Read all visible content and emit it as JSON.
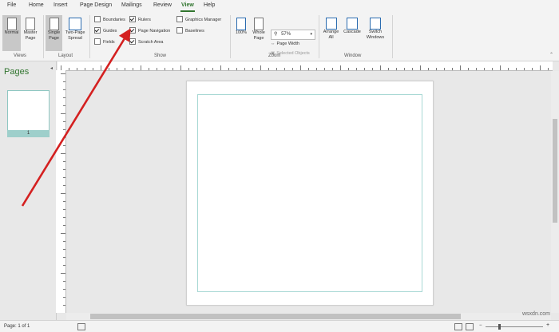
{
  "menu": {
    "items": [
      "File",
      "Home",
      "Insert",
      "Page Design",
      "Mailings",
      "Review",
      "View",
      "Help"
    ],
    "active": "View"
  },
  "ribbon": {
    "views": {
      "normal": "Normal",
      "master": "Master Page",
      "label": "Views"
    },
    "layout": {
      "single": "Single Page",
      "two_page": "Two-Page Spread",
      "label": "Layout"
    },
    "show": {
      "boundaries": "Boundaries",
      "rulers": "Rulers",
      "graphics_manager": "Graphics Manager",
      "guides": "Guides",
      "page_navigation": "Page Navigation",
      "baselines": "Baselines",
      "fields": "Fields",
      "scratch_area": "Scratch Area",
      "label": "Show"
    },
    "zoom": {
      "hundred": "100%",
      "whole_page": "Whole Page",
      "zoom_value": "57%",
      "page_width": "Page Width",
      "selected_objects": "Selected Objects",
      "label": "Zoom"
    },
    "window": {
      "arrange": "Arrange All",
      "cascade": "Cascade",
      "switch": "Switch Windows",
      "label": "Window"
    }
  },
  "pages_panel": {
    "title": "Pages",
    "page_number": "1"
  },
  "status": {
    "page_info": "Page: 1 of 1"
  },
  "watermark": "wsxdn.com",
  "colors": {
    "accent": "#31752f",
    "arrow": "#d42020"
  }
}
